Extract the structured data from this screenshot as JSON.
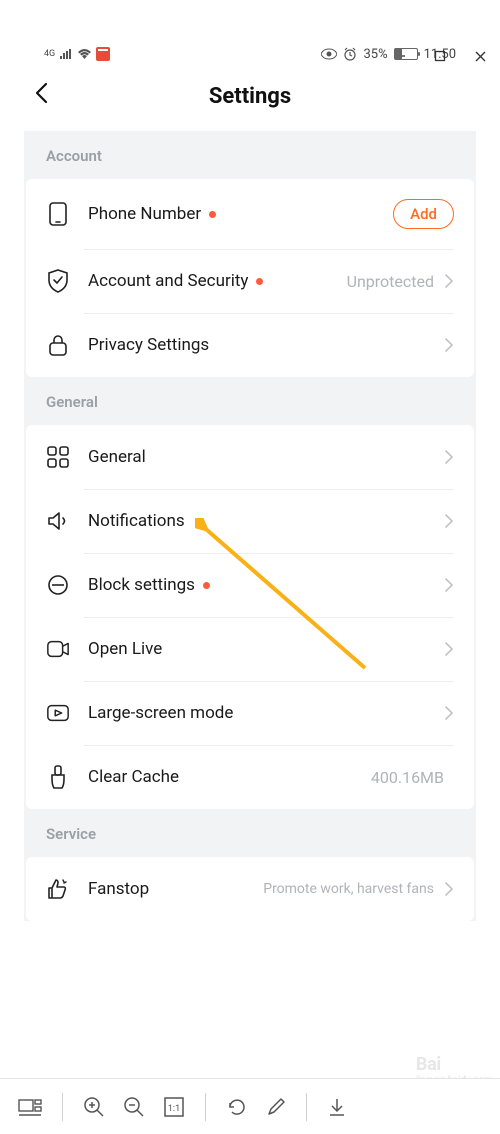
{
  "window": {
    "minimize": "—",
    "maximize": "▢",
    "close": "✕"
  },
  "status": {
    "network": "4G",
    "battery_pct": "35%",
    "time": "11:50"
  },
  "header": {
    "title": "Settings"
  },
  "sections": {
    "account": {
      "header": "Account",
      "phone_number": {
        "label": "Phone Number",
        "action": "Add"
      },
      "security": {
        "label": "Account and Security",
        "value": "Unprotected"
      },
      "privacy": {
        "label": "Privacy Settings"
      }
    },
    "general": {
      "header": "General",
      "general": {
        "label": "General"
      },
      "notifications": {
        "label": "Notifications"
      },
      "block": {
        "label": "Block settings"
      },
      "open_live": {
        "label": "Open Live"
      },
      "large_screen": {
        "label": "Large-screen mode"
      },
      "clear_cache": {
        "label": "Clear Cache",
        "value": "400.16MB"
      }
    },
    "service": {
      "header": "Service",
      "fanstop": {
        "label": "Fanstop",
        "value": "Promote work, harvest fans"
      }
    }
  },
  "watermark": {
    "brand": "Bai",
    "text": "jingyan.baidu.com"
  }
}
